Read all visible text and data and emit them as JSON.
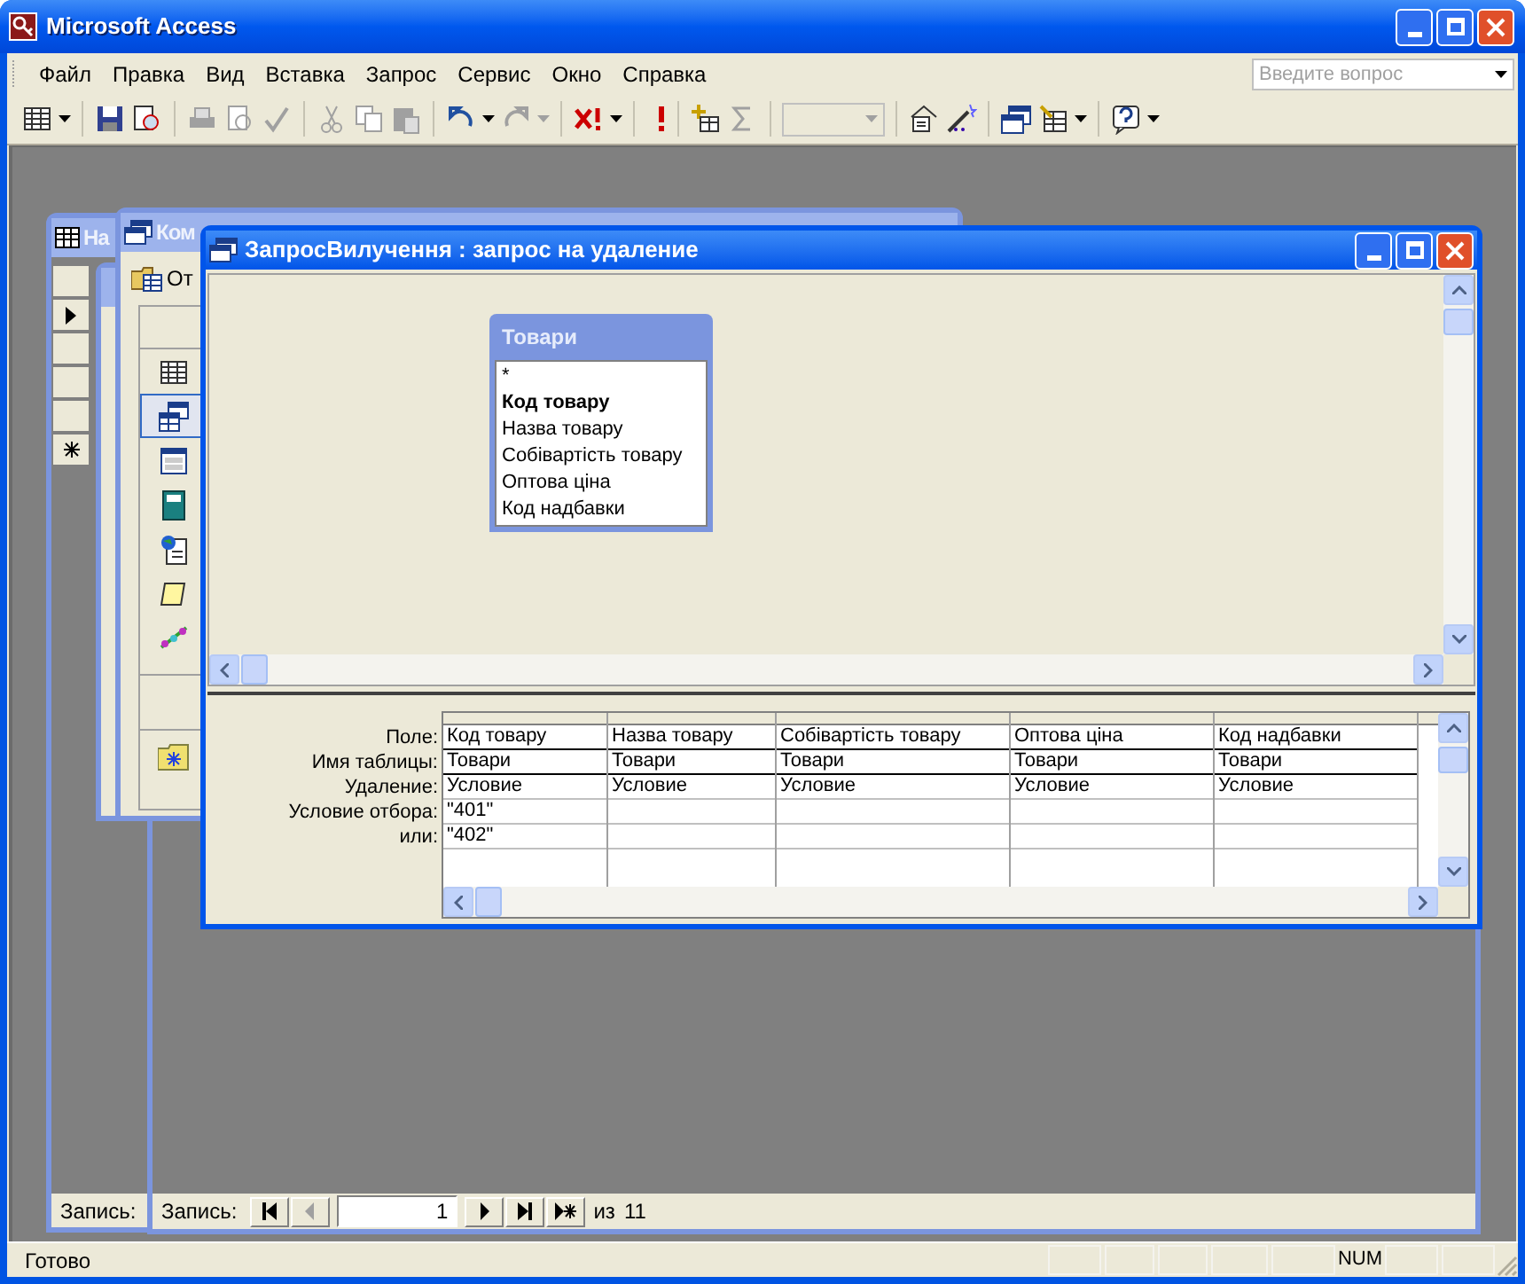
{
  "app": {
    "title": "Microsoft Access"
  },
  "menu": [
    {
      "label": "Файл"
    },
    {
      "label": "Правка"
    },
    {
      "label": "Вид"
    },
    {
      "label": "Вставка"
    },
    {
      "label": "Запрос"
    },
    {
      "label": "Сервис"
    },
    {
      "label": "Окно"
    },
    {
      "label": "Справка"
    }
  ],
  "help_search": {
    "placeholder": "Введите вопрос"
  },
  "background_windows": [
    {
      "kind": "datasheet",
      "title": "На",
      "navigator": {
        "label": "Запись:"
      }
    },
    {
      "kind": "database",
      "title": "Ком",
      "toolbar_button": "От"
    }
  ],
  "form_window": {
    "navigator": {
      "label": "Запись:",
      "record": "1",
      "total_label": "из",
      "total": "11"
    }
  },
  "query_window": {
    "title": "ЗапросВилучення : запрос на удаление",
    "field_list": {
      "title": "Товари",
      "fields": [
        {
          "name": "*",
          "primary_key": false
        },
        {
          "name": "Код товару",
          "primary_key": true
        },
        {
          "name": "Назва товару",
          "primary_key": false
        },
        {
          "name": "Собівартість товару",
          "primary_key": false
        },
        {
          "name": "Оптова ціна",
          "primary_key": false
        },
        {
          "name": "Код надбавки",
          "primary_key": false
        }
      ]
    },
    "grid": {
      "row_labels": [
        "Поле:",
        "Имя таблицы:",
        "Удаление:",
        "Условие отбора:",
        "или:"
      ],
      "columns": [
        {
          "cells": [
            "Код товару",
            "Товари",
            "Условие",
            "\"401\"",
            "\"402\""
          ]
        },
        {
          "cells": [
            "Назва товару",
            "Товари",
            "Условие",
            "",
            ""
          ]
        },
        {
          "cells": [
            "Собівартість товару",
            "Товари",
            "Условие",
            "",
            ""
          ]
        },
        {
          "cells": [
            "Оптова ціна",
            "Товари",
            "Условие",
            "",
            ""
          ]
        },
        {
          "cells": [
            "Код надбавки",
            "Товари",
            "Условие",
            "",
            ""
          ]
        }
      ]
    }
  },
  "status_bar": {
    "text": "Готово",
    "indicator": "NUM"
  }
}
